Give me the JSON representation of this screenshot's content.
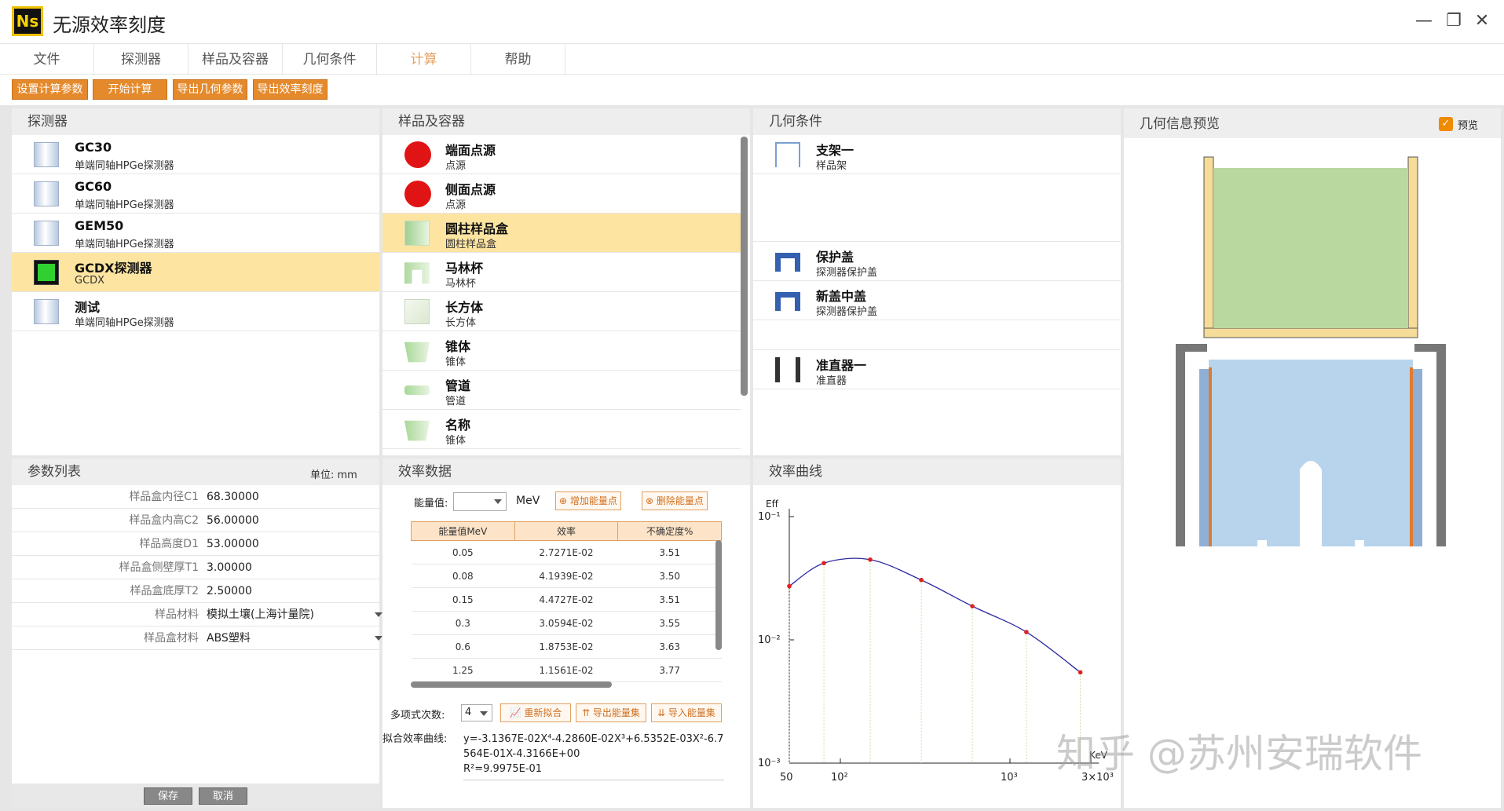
{
  "app": {
    "logo": "Ns",
    "title": "无源效率刻度",
    "minimize": "—",
    "maximize": "❐",
    "close": "✕"
  },
  "menu": [
    "文件",
    "探测器",
    "样品及容器",
    "几何条件",
    "计算",
    "帮助"
  ],
  "toolbar": [
    "设置计算参数",
    "开始计算",
    "导出几何参数",
    "导出效率刻度"
  ],
  "detector_panel": {
    "title": "探测器",
    "items": [
      {
        "name": "GC30",
        "desc": "单端同轴HPGe探测器",
        "icon": "detector-icon"
      },
      {
        "name": "GC60",
        "desc": "单端同轴HPGe探测器",
        "icon": "detector-icon"
      },
      {
        "name": "GEM50",
        "desc": "单端同轴HPGe探测器",
        "icon": "detector-icon"
      },
      {
        "name": "GCDX探测器",
        "desc": "GCDX",
        "icon": "gcdx-icon"
      },
      {
        "name": "测试",
        "desc": "单端同轴HPGe探测器",
        "icon": "detector-icon"
      }
    ]
  },
  "sample_panel": {
    "title": "样品及容器",
    "items": [
      {
        "name": "端面点源",
        "desc": "点源"
      },
      {
        "name": "侧面点源",
        "desc": "点源"
      },
      {
        "name": "圆柱样品盒",
        "desc": "圆柱样品盒"
      },
      {
        "name": "马林杯",
        "desc": "马林杯"
      },
      {
        "name": "长方体",
        "desc": "长方体"
      },
      {
        "name": "锥体",
        "desc": "锥体"
      },
      {
        "name": "管道",
        "desc": "管道"
      },
      {
        "name": "名称",
        "desc": "锥体"
      }
    ]
  },
  "geometry_panel": {
    "title": "几何条件",
    "items": [
      {
        "name": "支架一",
        "desc": "样品架"
      },
      {
        "name": "保护盖",
        "desc": "探测器保护盖"
      },
      {
        "name": "新盖中盖",
        "desc": "探测器保护盖"
      },
      {
        "name": "准直器一",
        "desc": "准直器"
      }
    ]
  },
  "preview_panel": {
    "title": "几何信息预览",
    "checkbox_label": "预览",
    "checked": true
  },
  "params_panel": {
    "title": "参数列表",
    "unit": "单位:  mm",
    "rows": [
      {
        "label": "样品盒内径C1",
        "value": "68.30000"
      },
      {
        "label": "样品盒内高C2",
        "value": "56.00000"
      },
      {
        "label": "样品高度D1",
        "value": "53.00000"
      },
      {
        "label": "样品盒侧壁厚T1",
        "value": "3.00000"
      },
      {
        "label": "样品盒底厚T2",
        "value": "2.50000"
      },
      {
        "label": "样品材料",
        "value": "模拟土壤(上海计量院)"
      },
      {
        "label": "样品盒材料",
        "value": "ABS塑料"
      }
    ],
    "save": "保存",
    "cancel": "取消"
  },
  "eff_data_panel": {
    "title": "效率数据",
    "energy_label": "能量值:",
    "energy_unit": "MeV",
    "add_btn": "增加能量点",
    "del_btn": "删除能量点",
    "columns": [
      "能量值MeV",
      "效率",
      "不确定度%"
    ],
    "rows": [
      [
        "0.05",
        "2.7271E-02",
        "3.51"
      ],
      [
        "0.08",
        "4.1939E-02",
        "3.50"
      ],
      [
        "0.15",
        "4.4727E-02",
        "3.51"
      ],
      [
        "0.3",
        "3.0594E-02",
        "3.55"
      ],
      [
        "0.6",
        "1.8753E-02",
        "3.63"
      ],
      [
        "1.25",
        "1.1561E-02",
        "3.77"
      ]
    ],
    "poly_label": "多项式次数:",
    "poly_value": "4",
    "refit_btn": "重新拟合",
    "export_btn": "导出能量集",
    "import_btn": "导入能量集",
    "fit_label": "拟合效率曲线:",
    "formula_line1": "y=-3.1367E-02X⁴-4.2860E-02X³+6.5352E-03X²-6.7",
    "formula_line2": "564E-01X-4.3166E+00",
    "formula_line3": "R²=9.9975E-01"
  },
  "curve_panel": {
    "title": "效率曲线"
  },
  "chart_data": {
    "type": "line",
    "ylabel": "Eff",
    "xlabel": "KeV",
    "xscale": "log",
    "yscale": "log",
    "xlim": [
      50,
      3000
    ],
    "ylim": [
      0.001,
      0.1
    ],
    "xticks": [
      "50",
      "10²",
      "10³",
      "3×10³"
    ],
    "yticks": [
      "10⁻¹",
      "10⁻²",
      "10⁻³"
    ],
    "points": [
      {
        "x": 50,
        "y": 0.027271
      },
      {
        "x": 80,
        "y": 0.041939
      },
      {
        "x": 150,
        "y": 0.044727
      },
      {
        "x": 300,
        "y": 0.030594
      },
      {
        "x": 600,
        "y": 0.018753
      },
      {
        "x": 1250,
        "y": 0.011561
      },
      {
        "x": 2600,
        "y": 0.00545
      }
    ],
    "curve_color": "#2a2aa0",
    "point_color": "#e02020"
  },
  "watermark": "知乎 @苏州安瑞软件"
}
